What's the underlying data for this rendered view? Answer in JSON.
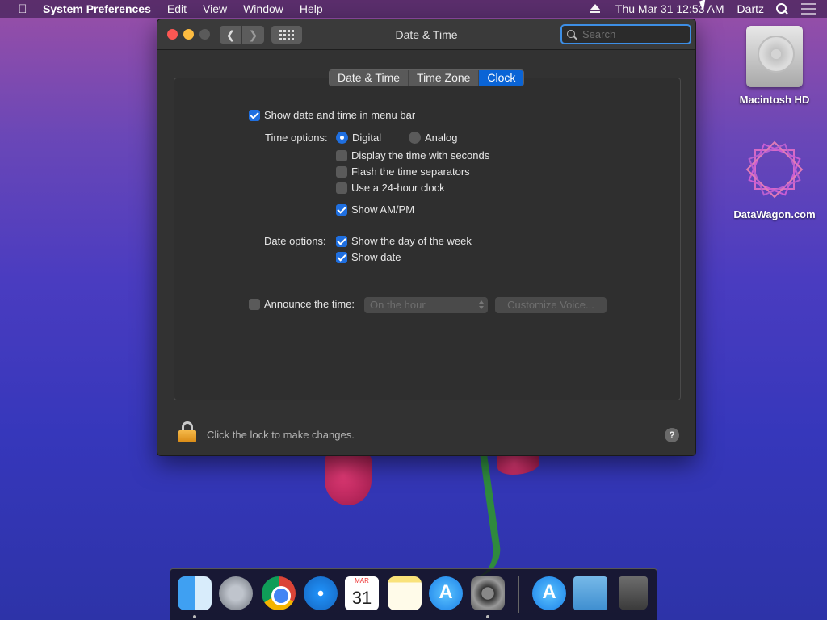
{
  "menubar": {
    "app_name": "System Preferences",
    "menus": [
      "Edit",
      "View",
      "Window",
      "Help"
    ],
    "clock": "Thu Mar 31  12:53 AM",
    "user": "Dartz"
  },
  "window": {
    "title": "Date & Time",
    "search_placeholder": "Search",
    "tabs": [
      {
        "label": "Date & Time",
        "active": false
      },
      {
        "label": "Time Zone",
        "active": false
      },
      {
        "label": "Clock",
        "active": true
      }
    ],
    "show_in_menu_bar": {
      "label": "Show date and time in menu bar",
      "checked": true
    },
    "time_options": {
      "label": "Time options:",
      "digital": {
        "label": "Digital",
        "selected": true
      },
      "analog": {
        "label": "Analog",
        "selected": false
      },
      "checkboxes": [
        {
          "label": "Display the time with seconds",
          "checked": false
        },
        {
          "label": "Flash the time separators",
          "checked": false
        },
        {
          "label": "Use a 24-hour clock",
          "checked": false
        },
        {
          "label": "Show AM/PM",
          "checked": true
        }
      ]
    },
    "date_options": {
      "label": "Date options:",
      "checkboxes": [
        {
          "label": "Show the day of the week",
          "checked": true
        },
        {
          "label": "Show date",
          "checked": true
        }
      ]
    },
    "announce": {
      "label": "Announce the time:",
      "checked": false,
      "interval": "On the hour",
      "customize_label": "Customize Voice..."
    },
    "footer": {
      "lock_text": "Click the lock to make changes.",
      "help_label": "?"
    }
  },
  "desktop": {
    "icons": [
      {
        "label": "Macintosh HD"
      },
      {
        "label": "DataWagon.com"
      }
    ]
  },
  "dock": {
    "calendar_day": "31"
  },
  "colors": {
    "accent": "#0a64d6",
    "window_bg": "#323232",
    "close": "#fc5753",
    "minimize": "#fdbc40"
  }
}
